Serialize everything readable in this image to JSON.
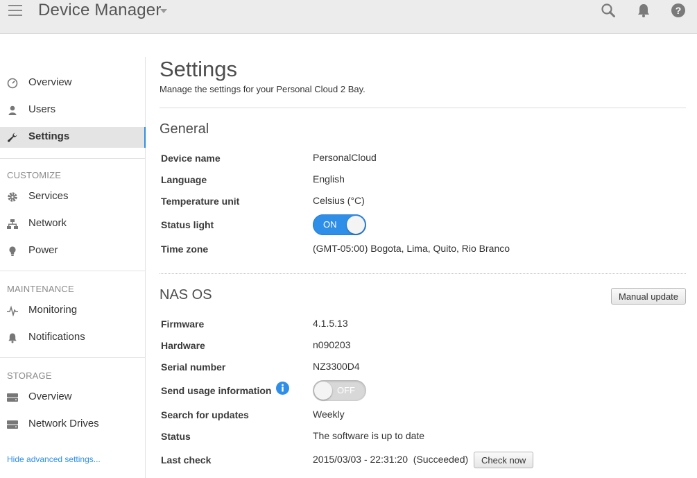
{
  "header": {
    "title": "Device Manager",
    "icons": [
      "menu-icon",
      "search-icon",
      "bell-icon",
      "help-icon"
    ]
  },
  "sidebar": {
    "items": [
      {
        "label": "Overview",
        "icon": "dashboard-icon"
      },
      {
        "label": "Users",
        "icon": "user-icon"
      },
      {
        "label": "Settings",
        "icon": "wrench-icon",
        "active": true
      }
    ],
    "customize": {
      "heading": "CUSTOMIZE",
      "items": [
        {
          "label": "Services",
          "icon": "gear-icon"
        },
        {
          "label": "Network",
          "icon": "network-icon"
        },
        {
          "label": "Power",
          "icon": "bulb-icon"
        }
      ]
    },
    "maintenance": {
      "heading": "MAINTENANCE",
      "items": [
        {
          "label": "Monitoring",
          "icon": "pulse-icon"
        },
        {
          "label": "Notifications",
          "icon": "bell-icon"
        }
      ]
    },
    "storage": {
      "heading": "STORAGE",
      "items": [
        {
          "label": "Overview",
          "icon": "drive-icon"
        },
        {
          "label": "Network Drives",
          "icon": "drive-icon"
        }
      ]
    },
    "hide_link": "Hide advanced settings..."
  },
  "main": {
    "title": "Settings",
    "subtitle": "Manage the settings for your Personal Cloud 2 Bay.",
    "general": {
      "title": "General",
      "rows": [
        {
          "label": "Device name",
          "value": "PersonalCloud"
        },
        {
          "label": "Language",
          "value": "English"
        },
        {
          "label": "Temperature unit",
          "value": "Celsius (°C)"
        },
        {
          "label": "Status light",
          "value": "ON"
        },
        {
          "label": "Time zone",
          "value": "(GMT-05:00) Bogota, Lima, Quito, Rio Branco"
        }
      ]
    },
    "nasos": {
      "title": "NAS OS",
      "manual_update": "Manual update",
      "rows": [
        {
          "label": "Firmware",
          "value": "4.1.5.13"
        },
        {
          "label": "Hardware",
          "value": "n090203"
        },
        {
          "label": "Serial number",
          "value": "NZ3300D4"
        },
        {
          "label": "Send usage information",
          "value": "OFF"
        },
        {
          "label": "Search for updates",
          "value": "Weekly"
        },
        {
          "label": "Status",
          "value": "The software is up to date"
        },
        {
          "label": "Last check",
          "value": "2015/03/03 - 22:31:20  (Succeeded)"
        }
      ],
      "check_now": "Check now"
    }
  },
  "colors": {
    "accent": "#2f8fe8",
    "topbar": "#ececec",
    "active_nav": "#e4e4e4"
  }
}
